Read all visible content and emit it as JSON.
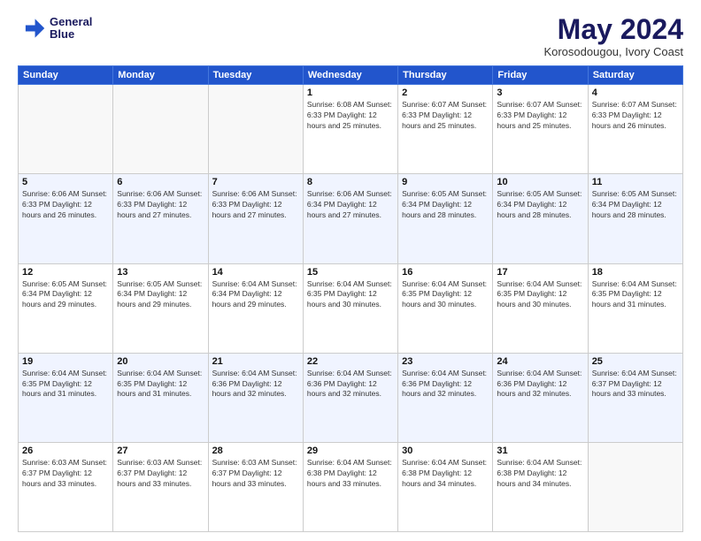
{
  "header": {
    "logo_line1": "General",
    "logo_line2": "Blue",
    "title": "May 2024",
    "location": "Korosodougou, Ivory Coast"
  },
  "days_of_week": [
    "Sunday",
    "Monday",
    "Tuesday",
    "Wednesday",
    "Thursday",
    "Friday",
    "Saturday"
  ],
  "weeks": [
    [
      {
        "num": "",
        "info": ""
      },
      {
        "num": "",
        "info": ""
      },
      {
        "num": "",
        "info": ""
      },
      {
        "num": "1",
        "info": "Sunrise: 6:08 AM\nSunset: 6:33 PM\nDaylight: 12 hours\nand 25 minutes."
      },
      {
        "num": "2",
        "info": "Sunrise: 6:07 AM\nSunset: 6:33 PM\nDaylight: 12 hours\nand 25 minutes."
      },
      {
        "num": "3",
        "info": "Sunrise: 6:07 AM\nSunset: 6:33 PM\nDaylight: 12 hours\nand 25 minutes."
      },
      {
        "num": "4",
        "info": "Sunrise: 6:07 AM\nSunset: 6:33 PM\nDaylight: 12 hours\nand 26 minutes."
      }
    ],
    [
      {
        "num": "5",
        "info": "Sunrise: 6:06 AM\nSunset: 6:33 PM\nDaylight: 12 hours\nand 26 minutes."
      },
      {
        "num": "6",
        "info": "Sunrise: 6:06 AM\nSunset: 6:33 PM\nDaylight: 12 hours\nand 27 minutes."
      },
      {
        "num": "7",
        "info": "Sunrise: 6:06 AM\nSunset: 6:33 PM\nDaylight: 12 hours\nand 27 minutes."
      },
      {
        "num": "8",
        "info": "Sunrise: 6:06 AM\nSunset: 6:34 PM\nDaylight: 12 hours\nand 27 minutes."
      },
      {
        "num": "9",
        "info": "Sunrise: 6:05 AM\nSunset: 6:34 PM\nDaylight: 12 hours\nand 28 minutes."
      },
      {
        "num": "10",
        "info": "Sunrise: 6:05 AM\nSunset: 6:34 PM\nDaylight: 12 hours\nand 28 minutes."
      },
      {
        "num": "11",
        "info": "Sunrise: 6:05 AM\nSunset: 6:34 PM\nDaylight: 12 hours\nand 28 minutes."
      }
    ],
    [
      {
        "num": "12",
        "info": "Sunrise: 6:05 AM\nSunset: 6:34 PM\nDaylight: 12 hours\nand 29 minutes."
      },
      {
        "num": "13",
        "info": "Sunrise: 6:05 AM\nSunset: 6:34 PM\nDaylight: 12 hours\nand 29 minutes."
      },
      {
        "num": "14",
        "info": "Sunrise: 6:04 AM\nSunset: 6:34 PM\nDaylight: 12 hours\nand 29 minutes."
      },
      {
        "num": "15",
        "info": "Sunrise: 6:04 AM\nSunset: 6:35 PM\nDaylight: 12 hours\nand 30 minutes."
      },
      {
        "num": "16",
        "info": "Sunrise: 6:04 AM\nSunset: 6:35 PM\nDaylight: 12 hours\nand 30 minutes."
      },
      {
        "num": "17",
        "info": "Sunrise: 6:04 AM\nSunset: 6:35 PM\nDaylight: 12 hours\nand 30 minutes."
      },
      {
        "num": "18",
        "info": "Sunrise: 6:04 AM\nSunset: 6:35 PM\nDaylight: 12 hours\nand 31 minutes."
      }
    ],
    [
      {
        "num": "19",
        "info": "Sunrise: 6:04 AM\nSunset: 6:35 PM\nDaylight: 12 hours\nand 31 minutes."
      },
      {
        "num": "20",
        "info": "Sunrise: 6:04 AM\nSunset: 6:35 PM\nDaylight: 12 hours\nand 31 minutes."
      },
      {
        "num": "21",
        "info": "Sunrise: 6:04 AM\nSunset: 6:36 PM\nDaylight: 12 hours\nand 32 minutes."
      },
      {
        "num": "22",
        "info": "Sunrise: 6:04 AM\nSunset: 6:36 PM\nDaylight: 12 hours\nand 32 minutes."
      },
      {
        "num": "23",
        "info": "Sunrise: 6:04 AM\nSunset: 6:36 PM\nDaylight: 12 hours\nand 32 minutes."
      },
      {
        "num": "24",
        "info": "Sunrise: 6:04 AM\nSunset: 6:36 PM\nDaylight: 12 hours\nand 32 minutes."
      },
      {
        "num": "25",
        "info": "Sunrise: 6:04 AM\nSunset: 6:37 PM\nDaylight: 12 hours\nand 33 minutes."
      }
    ],
    [
      {
        "num": "26",
        "info": "Sunrise: 6:03 AM\nSunset: 6:37 PM\nDaylight: 12 hours\nand 33 minutes."
      },
      {
        "num": "27",
        "info": "Sunrise: 6:03 AM\nSunset: 6:37 PM\nDaylight: 12 hours\nand 33 minutes."
      },
      {
        "num": "28",
        "info": "Sunrise: 6:03 AM\nSunset: 6:37 PM\nDaylight: 12 hours\nand 33 minutes."
      },
      {
        "num": "29",
        "info": "Sunrise: 6:04 AM\nSunset: 6:38 PM\nDaylight: 12 hours\nand 33 minutes."
      },
      {
        "num": "30",
        "info": "Sunrise: 6:04 AM\nSunset: 6:38 PM\nDaylight: 12 hours\nand 34 minutes."
      },
      {
        "num": "31",
        "info": "Sunrise: 6:04 AM\nSunset: 6:38 PM\nDaylight: 12 hours\nand 34 minutes."
      },
      {
        "num": "",
        "info": ""
      }
    ]
  ]
}
